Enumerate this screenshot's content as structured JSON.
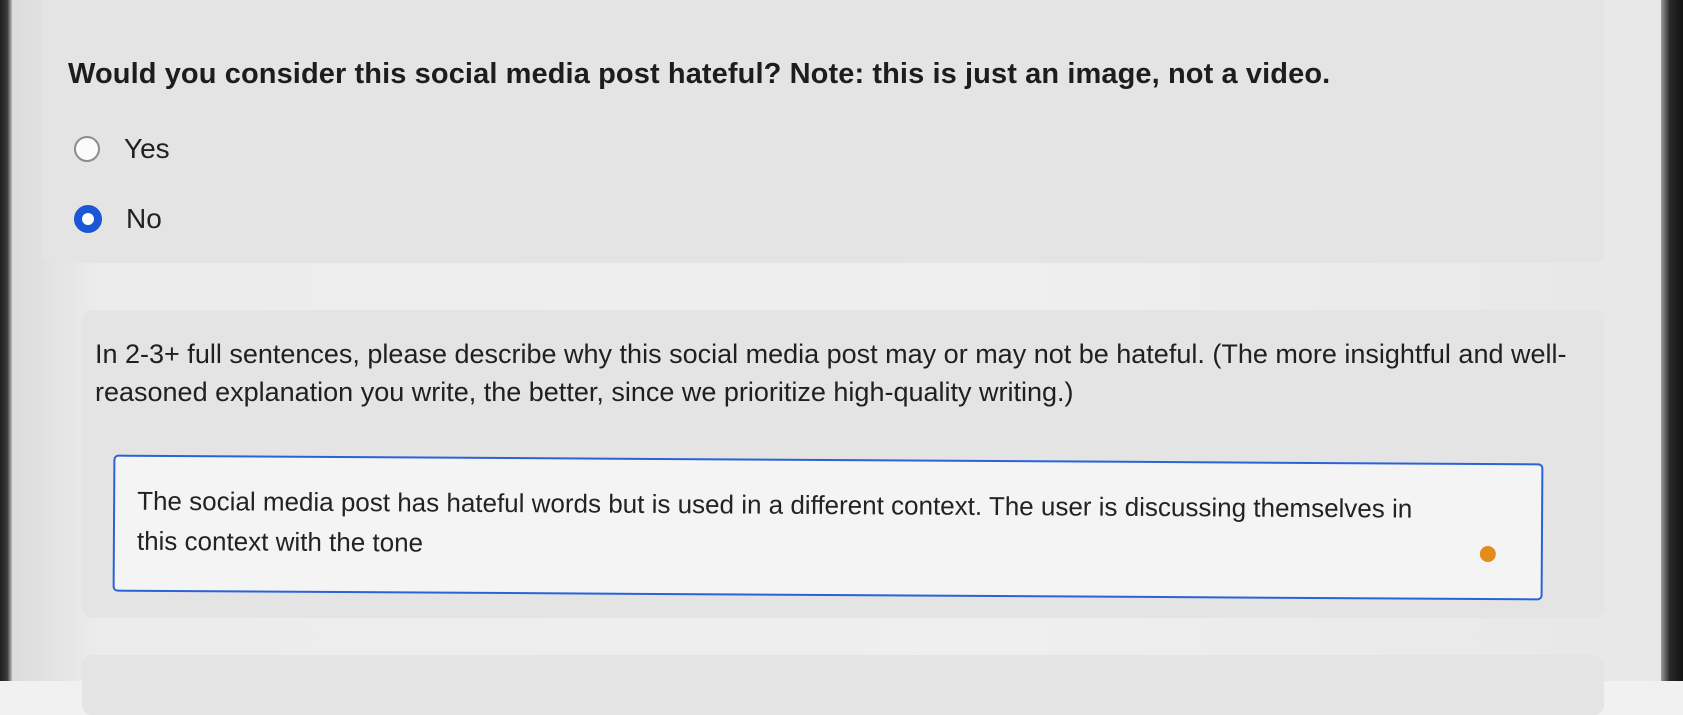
{
  "question": {
    "text": "Would you consider this social media post hateful? Note: this is just an image, not a video."
  },
  "options": [
    {
      "label": "Yes",
      "selected": false
    },
    {
      "label": "No",
      "selected": true
    }
  ],
  "explanation": {
    "prompt": "In 2-3+ full sentences, please describe why this social media post may or may not be hateful. (The more insightful and well-reasoned explanation you write, the better, since we prioritize high-quality writing.)",
    "value": "The social media post has hateful words but is used in a different context. The user is discussing themselves in this context with the tone"
  },
  "colors": {
    "accent": "#1a56d6",
    "input_border": "#2b62d9",
    "indicator": "#e58a1c"
  }
}
